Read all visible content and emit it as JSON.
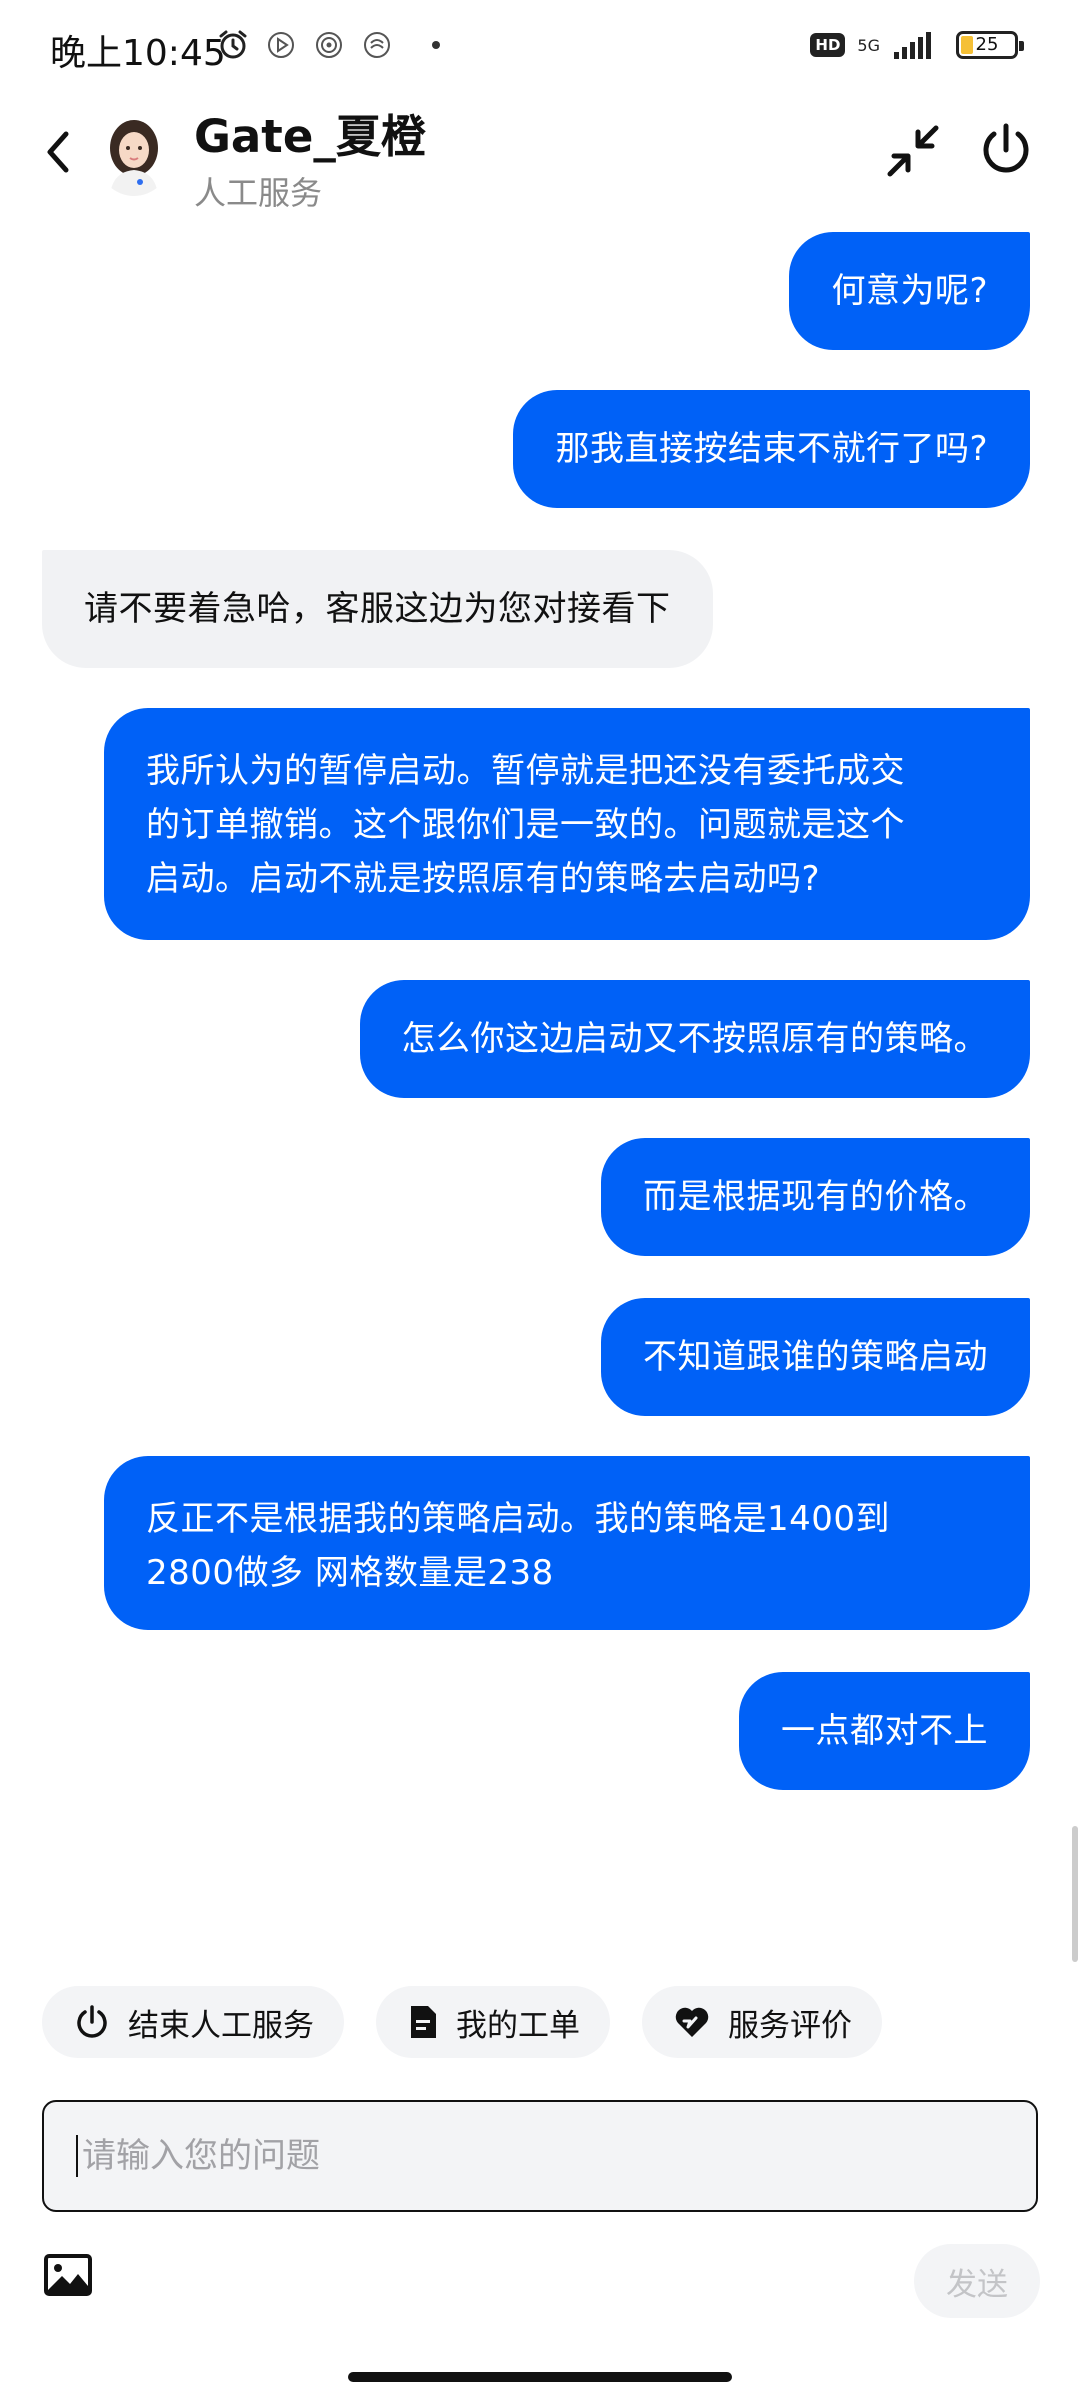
{
  "status_bar": {
    "time": "晚上10:45",
    "hd_label": "HD",
    "network": "5G",
    "battery": "25",
    "icons": [
      "alarm-icon",
      "play-store-icon",
      "fingerprint-icon",
      "fingerprint-icon",
      "dot-icon"
    ]
  },
  "header": {
    "agent_name": "Gate_夏橙",
    "subtitle": "人工服务"
  },
  "messages": [
    {
      "from": "user",
      "text": "何意为呢?"
    },
    {
      "from": "user",
      "text": "那我直接按结束不就行了吗?"
    },
    {
      "from": "agent",
      "text": "请不要着急哈，客服这边为您对接看下"
    },
    {
      "from": "user",
      "lines": [
        "我所认为的暂停启动。暂停就是把还没有委托成交",
        "的订单撤销。这个跟你们是一致的。问题就是这个",
        "启动。启动不就是按照原有的策略去启动吗?"
      ]
    },
    {
      "from": "user",
      "text": "怎么你这边启动又不按照原有的策略。"
    },
    {
      "from": "user",
      "text": "而是根据现有的价格。"
    },
    {
      "from": "user",
      "text": "不知道跟谁的策略启动"
    },
    {
      "from": "user",
      "lines": [
        "反正不是根据我的策略启动。我的策略是1400到",
        "2800做多 网格数量是238"
      ]
    },
    {
      "from": "user",
      "text": "一点都对不上"
    }
  ],
  "quick_actions": [
    {
      "label": "结束人工服务",
      "icon": "power-icon"
    },
    {
      "label": "我的工单",
      "icon": "document-icon"
    },
    {
      "label": "服务评价",
      "icon": "heart-rating-icon"
    }
  ],
  "input": {
    "placeholder": "请输入您的问题",
    "value": ""
  },
  "send_label": "发送",
  "colors": {
    "user_bubble": "#0061f7",
    "agent_bubble": "#f1f2f4",
    "chip_bg": "#f3f4f6"
  }
}
